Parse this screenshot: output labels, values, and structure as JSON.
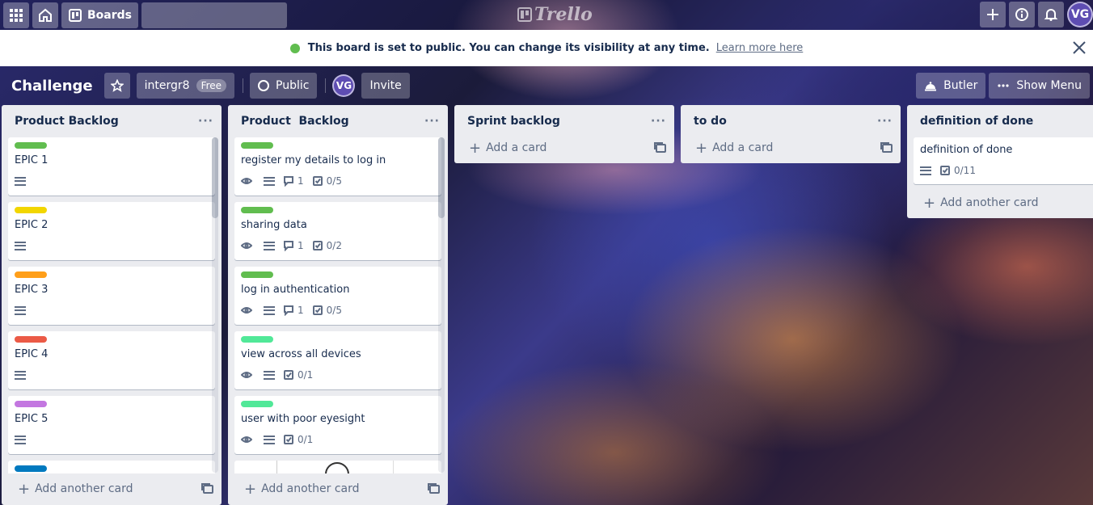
{
  "header": {
    "boards_label": "Boards",
    "search_placeholder": "",
    "logo_text": "Trello",
    "user_initials": "VG"
  },
  "notice": {
    "message": "This board is set to public. You can change its visibility at any time.",
    "link": "Learn more here"
  },
  "board": {
    "title": "Challenge",
    "team": "intergr8",
    "team_badge": "Free",
    "visibility": "Public",
    "member_initials": "VG",
    "invite_label": "Invite",
    "butler_label": "Butler",
    "show_menu_label": "Show Menu"
  },
  "colors": {
    "green": "#61bd4f",
    "yellow": "#f2d600",
    "orange": "#ff9f1a",
    "red": "#eb5a46",
    "purple": "#c377e0",
    "lime": "#51e898",
    "blue": "#0079bf"
  },
  "lists": [
    {
      "title": "Product Backlog",
      "footer": "Add another card",
      "cards": [
        {
          "title": "EPIC 1",
          "label_color": "#61bd4f"
        },
        {
          "title": "EPIC 2",
          "label_color": "#f2d600"
        },
        {
          "title": "EPIC 3",
          "label_color": "#ff9f1a"
        },
        {
          "title": "EPIC 4",
          "label_color": "#eb5a46"
        },
        {
          "title": "EPIC 5",
          "label_color": "#c377e0"
        }
      ]
    },
    {
      "title": "Product  Backlog",
      "footer": "Add another card",
      "cards": [
        {
          "title": "register my details to log in",
          "label_color": "#61bd4f",
          "comments": "1",
          "checklist": "0/5"
        },
        {
          "title": "sharing data",
          "label_color": "#61bd4f",
          "comments": "1",
          "checklist": "0/2"
        },
        {
          "title": "log in authentication",
          "label_color": "#61bd4f",
          "comments": "1",
          "checklist": "0/5"
        },
        {
          "title": "view across all devices",
          "label_color": "#51e898",
          "checklist": "0/1"
        },
        {
          "title": "user with poor eyesight",
          "label_color": "#51e898",
          "checklist": "0/1"
        }
      ]
    },
    {
      "title": "Sprint backlog",
      "footer": "Add a card"
    },
    {
      "title": "to do",
      "footer": "Add a card"
    },
    {
      "title": "definition of done",
      "footer": "Add another card",
      "cards": [
        {
          "title": "definition of done",
          "checklist": "0/11"
        }
      ]
    }
  ]
}
